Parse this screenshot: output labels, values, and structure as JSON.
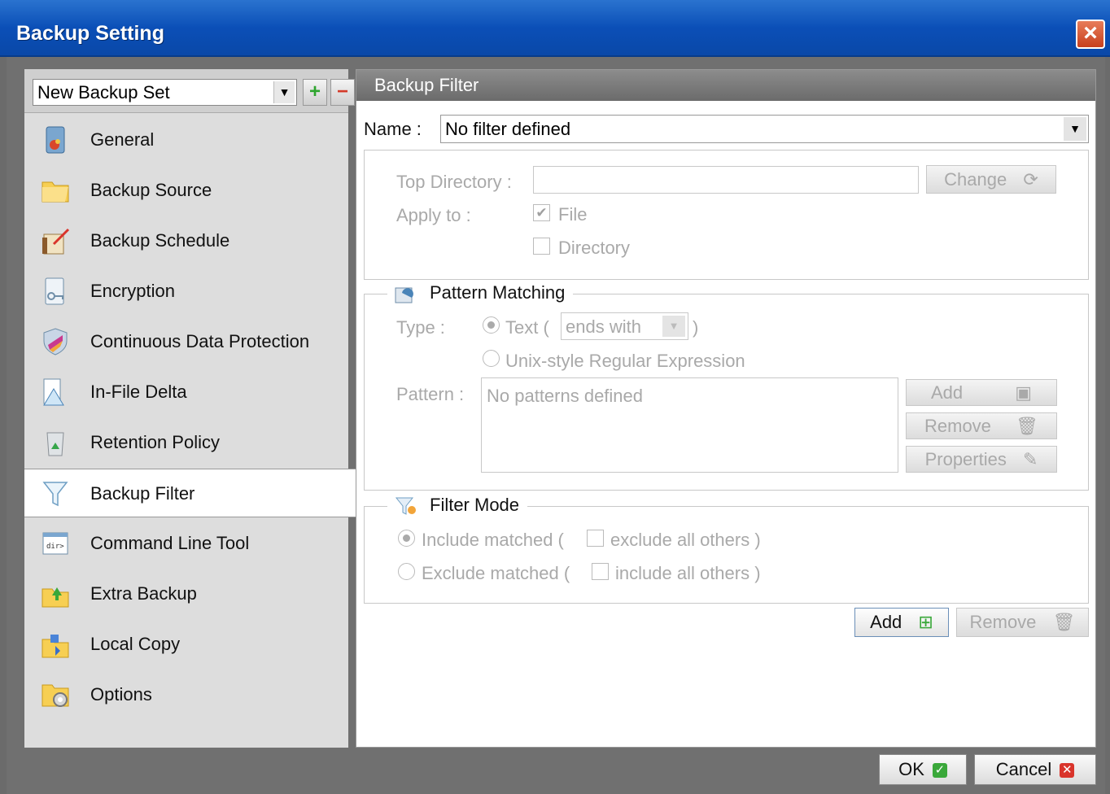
{
  "window": {
    "title": "Backup Setting",
    "close_label": "×"
  },
  "backup_set": {
    "selected": "New Backup Set",
    "add_label": "+",
    "remove_label": "−"
  },
  "nav": {
    "items": [
      {
        "label": "General",
        "icon": "general-icon"
      },
      {
        "label": "Backup Source",
        "icon": "folder-icon"
      },
      {
        "label": "Backup Schedule",
        "icon": "schedule-icon"
      },
      {
        "label": "Encryption",
        "icon": "encryption-icon"
      },
      {
        "label": "Continuous Data Protection",
        "icon": "shield-icon"
      },
      {
        "label": "In-File Delta",
        "icon": "delta-icon"
      },
      {
        "label": "Retention Policy",
        "icon": "recycle-bin-icon"
      },
      {
        "label": "Backup Filter",
        "icon": "funnel-icon"
      },
      {
        "label": "Command Line Tool",
        "icon": "command-line-icon"
      },
      {
        "label": "Extra Backup",
        "icon": "extra-backup-icon"
      },
      {
        "label": "Local Copy",
        "icon": "local-copy-icon"
      },
      {
        "label": "Options",
        "icon": "options-icon"
      }
    ],
    "active": "Backup Filter"
  },
  "panel": {
    "header": "Backup Filter",
    "name_label": "Name :",
    "name_value": "No filter defined",
    "top_directory_label": "Top Directory :",
    "top_directory_value": "",
    "change_button": "Change",
    "apply_to_label": "Apply to :",
    "apply_file_label": "File",
    "apply_directory_label": "Directory",
    "pattern_matching": {
      "legend": "Pattern Matching",
      "type_label": "Type :",
      "text_option": "Text (",
      "text_close": ")",
      "ends_with_value": "ends with",
      "regex_option": "Unix-style Regular Expression",
      "pattern_label": "Pattern :",
      "pattern_placeholder": "No patterns defined",
      "add_button": "Add",
      "remove_button": "Remove",
      "properties_button": "Properties"
    },
    "filter_mode": {
      "legend": "Filter Mode",
      "include_matched": "Include matched (",
      "exclude_all_others": "exclude all others )",
      "exclude_matched": "Exclude matched (",
      "include_all_others": "include all others )"
    },
    "add_filter_button": "Add",
    "remove_filter_button": "Remove"
  },
  "footer": {
    "ok_button": "OK",
    "cancel_button": "Cancel"
  },
  "colors": {
    "title_bar": "#0b4fb7",
    "ok_badge": "#3aa83a",
    "cancel_badge": "#d9342b"
  }
}
